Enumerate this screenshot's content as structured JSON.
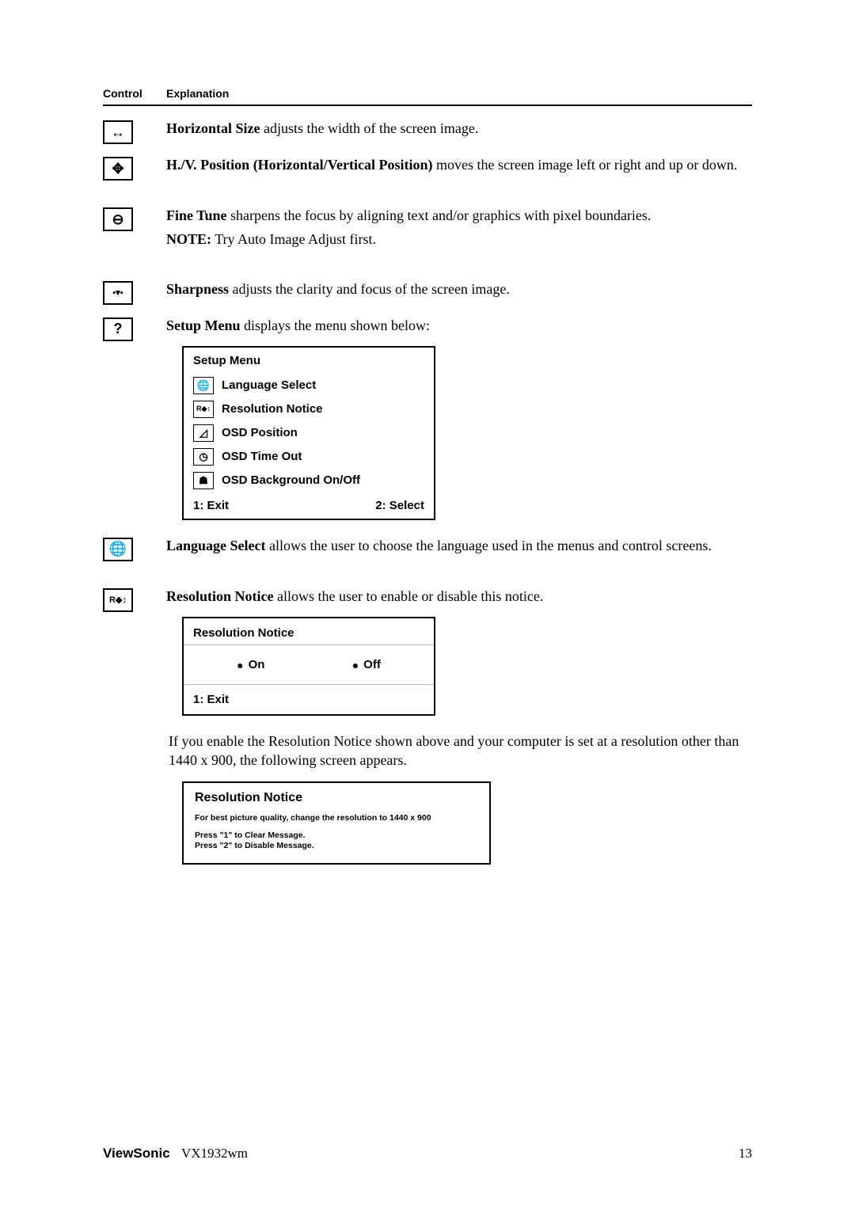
{
  "header": {
    "control": "Control",
    "explanation": "Explanation"
  },
  "items": {
    "hsize": {
      "title": "Horizontal Size",
      "body": " adjusts the width of the screen image."
    },
    "hvpos": {
      "title": "H./V. Position (Horizontal/Vertical Position)",
      "body": " moves the screen image left or right and up or down."
    },
    "finetune": {
      "title": "Fine Tune",
      "body": " sharpens the focus by aligning text and/or graphics with pixel boundaries.",
      "note_label": "NOTE:",
      "note_body": " Try Auto Image Adjust first."
    },
    "sharpness": {
      "title": "Sharpness",
      "body": " adjusts the clarity and focus of the screen image."
    },
    "setupmenu": {
      "title": "Setup Menu",
      "body": " displays the menu shown below:"
    },
    "langselect": {
      "title": "Language Select",
      "body": " allows the user to choose the language used in the menus and control screens."
    },
    "resnotice": {
      "title": "Resolution Notice",
      "body": " allows the user to enable or disable this notice."
    }
  },
  "osd_setup": {
    "title": "Setup Menu",
    "items": [
      {
        "icon": "🌐",
        "label": "Language Select"
      },
      {
        "icon": "R◆↕",
        "label": "Resolution Notice"
      },
      {
        "icon": "◿",
        "label": "OSD Position"
      },
      {
        "icon": "◷",
        "label": "OSD Time Out"
      },
      {
        "icon": "☗",
        "label": "OSD Background On/Off"
      }
    ],
    "footer_left": "1: Exit",
    "footer_right": "2: Select"
  },
  "res_panel": {
    "title": "Resolution Notice",
    "on": "On",
    "off": "Off",
    "footer": "1: Exit"
  },
  "res_after": "If you enable the Resolution Notice shown above and your computer is set at a resolution other than 1440 x 900, the following screen appears.",
  "notice_panel": {
    "title": "Resolution Notice",
    "sub": "For best picture quality, change the resolution to 1440 x 900",
    "line1": "Press \"1\" to Clear Message.",
    "line2": "Press \"2\" to Disable Message."
  },
  "footer": {
    "brand": "ViewSonic",
    "model": "VX1932wm",
    "page": "13"
  },
  "icons": {
    "hsize": "↔",
    "hvpos": "✥",
    "finetune": "⊖",
    "sharpness": "▪▾▪",
    "setupmenu": "?",
    "langselect": "🌐",
    "resnotice": "R◆↕"
  }
}
